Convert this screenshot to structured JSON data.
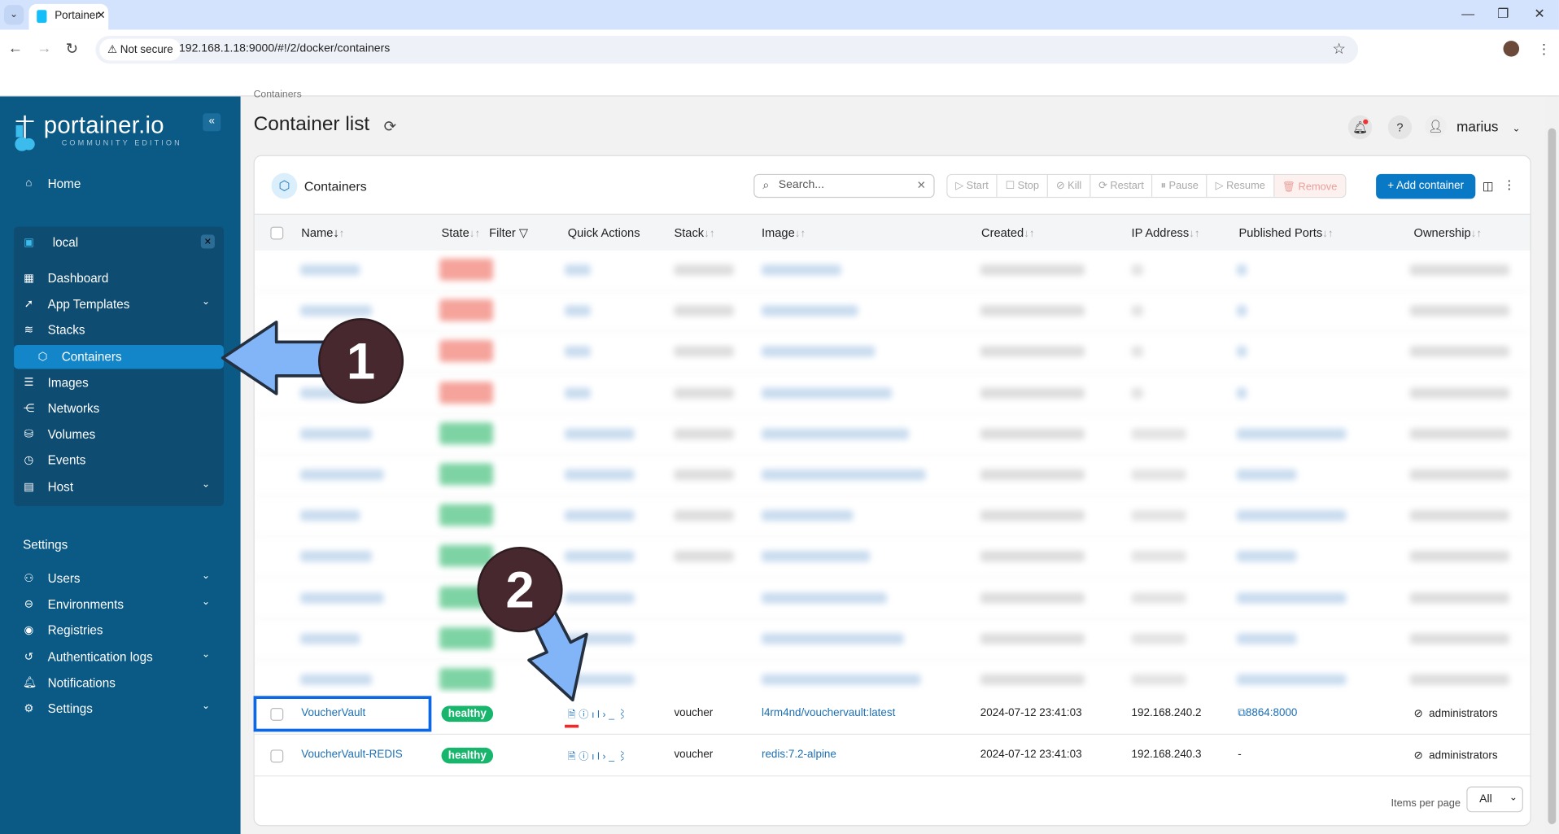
{
  "browser": {
    "tab_title": "Portainer",
    "security_label": "Not secure",
    "url": "192.168.1.18:9000/#!/2/docker/containers"
  },
  "sidebar": {
    "logo_text": "portainer.io",
    "logo_subtitle": "COMMUNITY EDITION",
    "home": "Home",
    "environment": "local",
    "env_items": [
      {
        "label": "Dashboard",
        "icon": "dashboard-icon"
      },
      {
        "label": "App Templates",
        "icon": "rocket-icon",
        "expandable": true
      },
      {
        "label": "Stacks",
        "icon": "layers-icon"
      },
      {
        "label": "Containers",
        "icon": "box-icon",
        "active": true
      },
      {
        "label": "Images",
        "icon": "list-icon"
      },
      {
        "label": "Networks",
        "icon": "share-icon"
      },
      {
        "label": "Volumes",
        "icon": "database-icon"
      },
      {
        "label": "Events",
        "icon": "clock-icon"
      },
      {
        "label": "Host",
        "icon": "server-icon",
        "expandable": true
      }
    ],
    "settings_heading": "Settings",
    "settings_items": [
      {
        "label": "Users",
        "icon": "users-icon",
        "expandable": true
      },
      {
        "label": "Environments",
        "icon": "plug-icon",
        "expandable": true
      },
      {
        "label": "Registries",
        "icon": "radio-icon"
      },
      {
        "label": "Authentication logs",
        "icon": "history-icon",
        "expandable": true
      },
      {
        "label": "Notifications",
        "icon": "bell-icon"
      },
      {
        "label": "Settings",
        "icon": "gear-icon",
        "expandable": true
      }
    ]
  },
  "header": {
    "breadcrumb": "Containers",
    "title": "Container list",
    "user": "marius"
  },
  "card": {
    "title": "Containers",
    "search_placeholder": "Search...",
    "actions": [
      "Start",
      "Stop",
      "Kill",
      "Restart",
      "Pause",
      "Resume",
      "Remove"
    ],
    "add_label": "+ Add container",
    "columns": [
      "Name",
      "State",
      "Filter",
      "Quick Actions",
      "Stack",
      "Image",
      "Created",
      "IP Address",
      "Published Ports",
      "Ownership"
    ],
    "rows": [
      {
        "name": "VoucherVault",
        "state": "healthy",
        "stack": "voucher",
        "image": "l4rm4nd/vouchervault:latest",
        "created": "2024-07-12 23:41:03",
        "ip": "192.168.240.2",
        "ports": "8864:8000",
        "ownership": "administrators"
      },
      {
        "name": "VoucherVault-REDIS",
        "state": "healthy",
        "stack": "voucher",
        "image": "redis:7.2-alpine",
        "created": "2024-07-12 23:41:03",
        "ip": "192.168.240.3",
        "ports": "-",
        "ownership": "administrators"
      }
    ],
    "items_per_page_label": "Items per page",
    "items_per_page_value": "All"
  },
  "annotations": {
    "step1": "1",
    "step2": "2"
  },
  "colors": {
    "sidebar": "#0b5a86",
    "accent": "#0a79c5",
    "healthy": "#17b66c",
    "stopped": "#f08a80",
    "annotation_arrow": "#82b4f8"
  }
}
